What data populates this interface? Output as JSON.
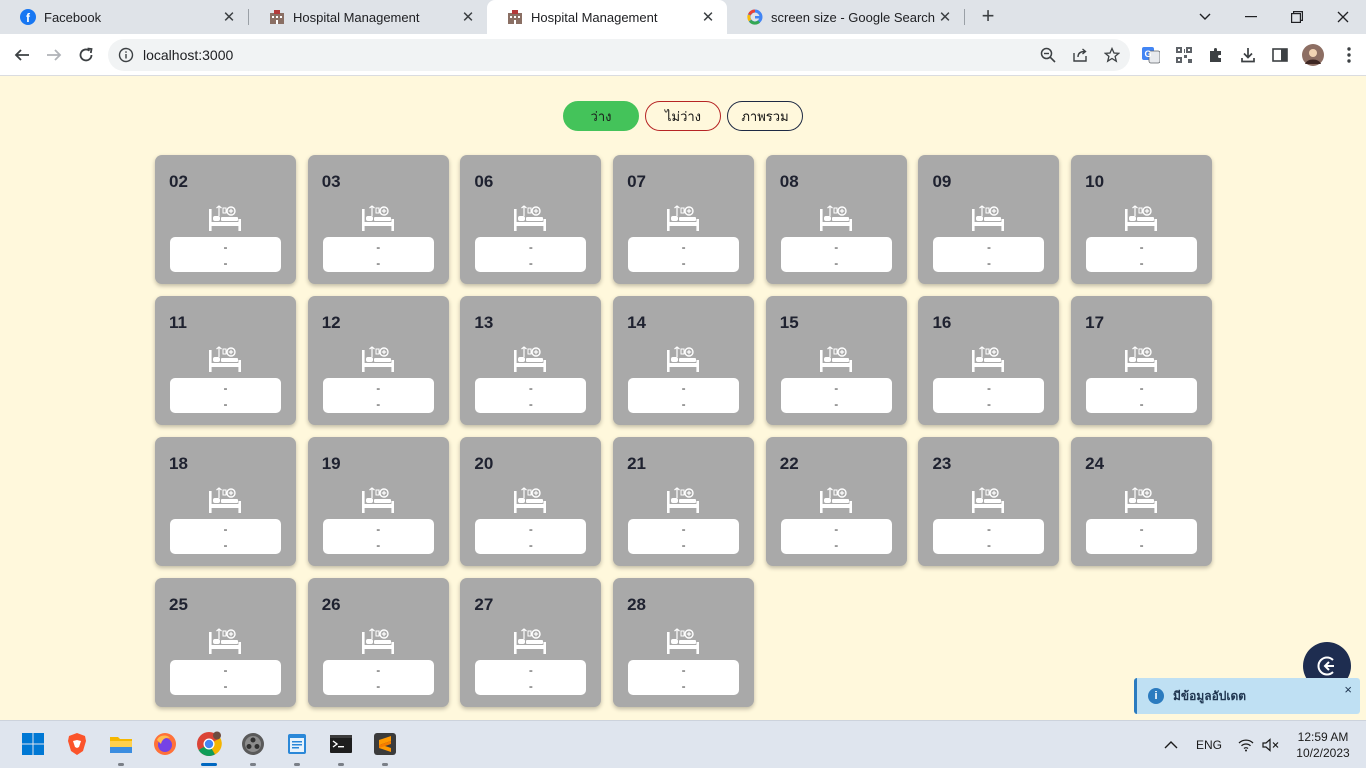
{
  "browser": {
    "tabs": [
      {
        "title": "Facebook",
        "icon": "facebook-icon"
      },
      {
        "title": "Hospital Management",
        "icon": "hospital-icon"
      },
      {
        "title": "Hospital Management",
        "icon": "hospital-icon",
        "active": true
      },
      {
        "title": "screen size - Google Search",
        "icon": "google-icon"
      }
    ],
    "url": "localhost:3000"
  },
  "filters": {
    "available": "ว่าง",
    "unavailable": "ไม่ว่าง",
    "overview": "ภาพรวม"
  },
  "beds": [
    {
      "number": "02",
      "line1": "-",
      "line2": "-"
    },
    {
      "number": "03",
      "line1": "-",
      "line2": "-"
    },
    {
      "number": "06",
      "line1": "-",
      "line2": "-"
    },
    {
      "number": "07",
      "line1": "-",
      "line2": "-"
    },
    {
      "number": "08",
      "line1": "-",
      "line2": "-"
    },
    {
      "number": "09",
      "line1": "-",
      "line2": "-"
    },
    {
      "number": "10",
      "line1": "-",
      "line2": "-"
    },
    {
      "number": "11",
      "line1": "-",
      "line2": "-"
    },
    {
      "number": "12",
      "line1": "-",
      "line2": "-"
    },
    {
      "number": "13",
      "line1": "-",
      "line2": "-"
    },
    {
      "number": "14",
      "line1": "-",
      "line2": "-"
    },
    {
      "number": "15",
      "line1": "-",
      "line2": "-"
    },
    {
      "number": "16",
      "line1": "-",
      "line2": "-"
    },
    {
      "number": "17",
      "line1": "-",
      "line2": "-"
    },
    {
      "number": "18",
      "line1": "-",
      "line2": "-"
    },
    {
      "number": "19",
      "line1": "-",
      "line2": "-"
    },
    {
      "number": "20",
      "line1": "-",
      "line2": "-"
    },
    {
      "number": "21",
      "line1": "-",
      "line2": "-"
    },
    {
      "number": "22",
      "line1": "-",
      "line2": "-"
    },
    {
      "number": "23",
      "line1": "-",
      "line2": "-"
    },
    {
      "number": "24",
      "line1": "-",
      "line2": "-"
    },
    {
      "number": "25",
      "line1": "-",
      "line2": "-"
    },
    {
      "number": "26",
      "line1": "-",
      "line2": "-"
    },
    {
      "number": "27",
      "line1": "-",
      "line2": "-"
    },
    {
      "number": "28",
      "line1": "-",
      "line2": "-"
    }
  ],
  "toast": {
    "message": "มีข้อมูลอัปเดต",
    "close": "×"
  },
  "taskbar": {
    "language": "ENG",
    "time": "12:59 AM",
    "date": "10/2/2023"
  },
  "colors": {
    "page_bg": "#fff8dc",
    "card_bg": "#a9a9a9",
    "available_green": "#44c35a",
    "unavailable_red": "#b62424",
    "overview_navy": "#1e2a44",
    "fab_navy": "#1e2d50",
    "toast_bg": "#bfe0f3"
  }
}
